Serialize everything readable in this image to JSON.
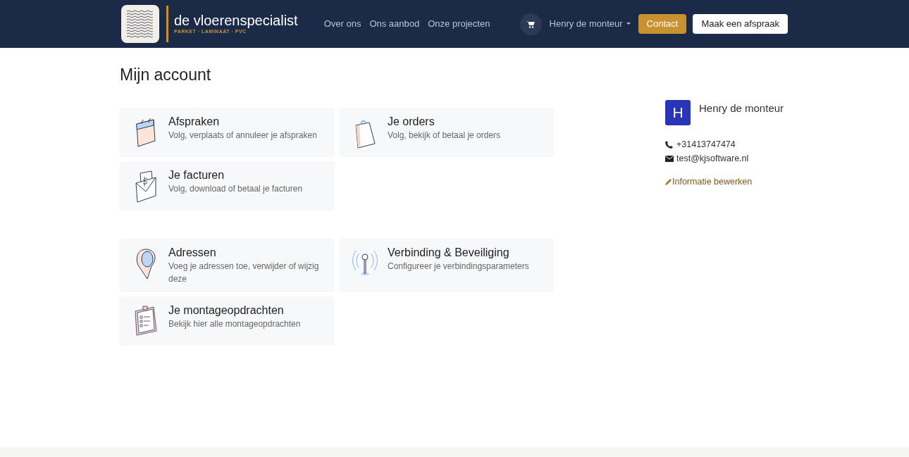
{
  "navbar": {
    "logo": {
      "name": "de vloerenspecialist",
      "tagline": "PARKET · LAMINAAT · PVC"
    },
    "links": [
      "Over ons",
      "Ons aanbod",
      "Onze projecten"
    ],
    "user_menu": "Henry de monteur",
    "contact_button": "Contact",
    "appointment_button": "Maak een afspraak"
  },
  "page_title": "Mijn account",
  "sections": [
    {
      "cards": [
        {
          "kind": "calendar",
          "title": "Afspraken",
          "description": "Volg, verplaats of annuleer je afspraken"
        },
        {
          "kind": "bag",
          "title": "Je orders",
          "description": "Volg, bekijk of betaal je orders"
        },
        {
          "kind": "envelope",
          "title": "Je facturen",
          "description": "Volg, download of betaal je facturen"
        }
      ]
    },
    {
      "cards": [
        {
          "kind": "pin",
          "title": "Adressen",
          "description": "Voeg je adressen toe, verwijder of wijzig deze"
        },
        {
          "kind": "antenna",
          "title": "Verbinding & Beveiliging",
          "description": "Configureer je verbindingsparameters"
        },
        {
          "kind": "clipboard",
          "title": "Je montageopdrachten",
          "description": "Bekijk hier alle montageopdrachten"
        }
      ]
    }
  ],
  "profile": {
    "initial": "H",
    "name": "Henry de monteur",
    "phone": "+31413747474",
    "email": "test@kjsoftware.nl",
    "edit_link": "Informatie bewerken"
  }
}
